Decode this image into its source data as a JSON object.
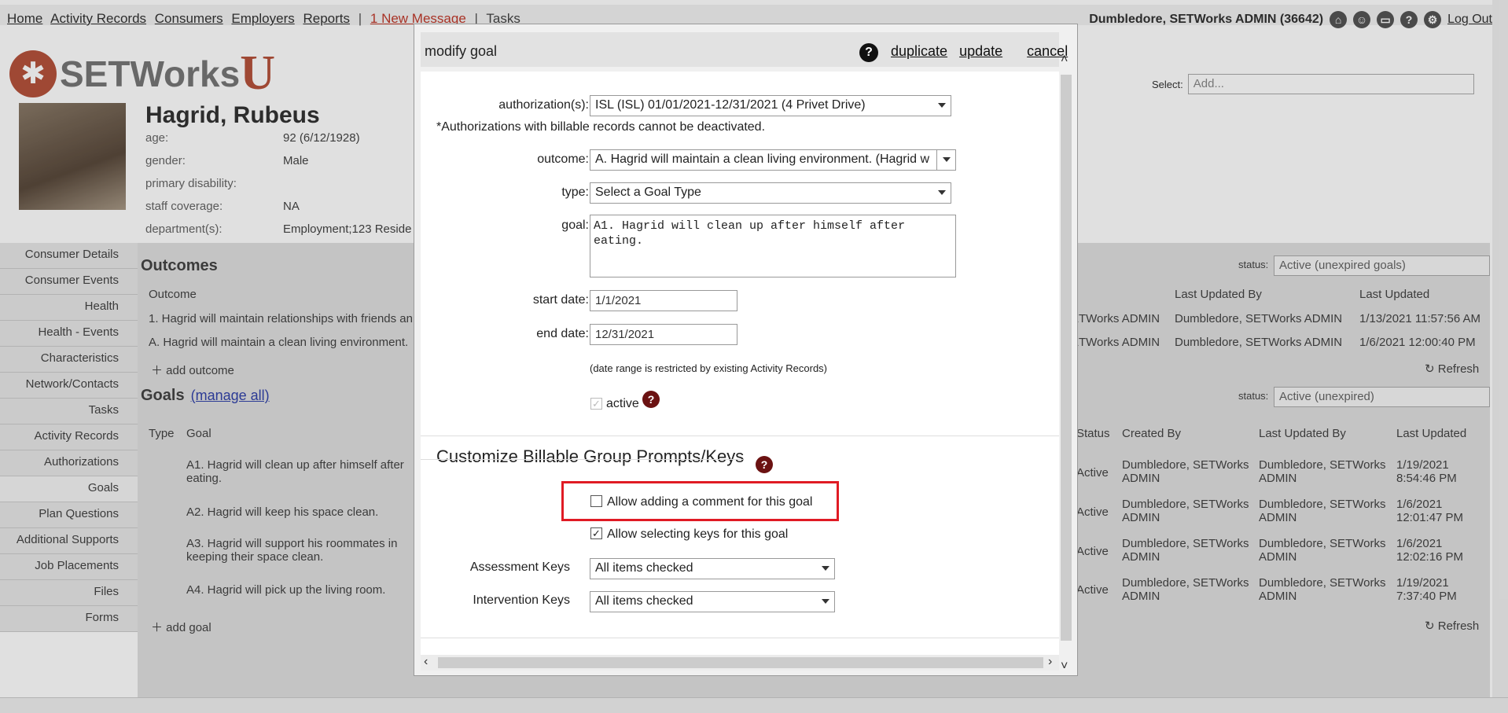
{
  "topnav": {
    "links": [
      "Home",
      "Activity Records",
      "Consumers",
      "Employers",
      "Reports"
    ],
    "message": "1 New Message",
    "tasks": "Tasks"
  },
  "user": {
    "name": "Dumbledore, SETWorks ADMIN  (36642)",
    "logout": "Log Out"
  },
  "logo": {
    "text": "SETWorks",
    "suffix": "U"
  },
  "select_add": {
    "label": "Select:",
    "value": "Add..."
  },
  "consumer": {
    "name": "Hagrid, Rubeus",
    "fields": [
      {
        "k": "age:",
        "v": "92 (6/12/1928)"
      },
      {
        "k": "gender:",
        "v": "Male"
      },
      {
        "k": "primary disability:",
        "v": ""
      },
      {
        "k": "staff coverage:",
        "v": "NA"
      },
      {
        "k": "department(s):",
        "v": "Employment;123 Reside"
      }
    ]
  },
  "leftnav": [
    "Consumer Details",
    "Consumer Events",
    "Health",
    "Health - Events",
    "Characteristics",
    "Network/Contacts",
    "Tasks",
    "Activity Records",
    "Authorizations",
    "Goals",
    "Plan Questions",
    "Additional Supports",
    "Job Placements",
    "Files",
    "Forms"
  ],
  "outcomes": {
    "title": "Outcomes",
    "status_label": "status:",
    "status_value": "Active (unexpired goals)",
    "col_outcome": "Outcome",
    "col_updated_by": "Last Updated By",
    "col_updated": "Last Updated",
    "rows": [
      {
        "text": "1. Hagrid will maintain relationships with friends an",
        "created": "ETWorks ADMIN",
        "by": "Dumbledore, SETWorks ADMIN",
        "date": "1/13/2021 11:57:56 AM"
      },
      {
        "text": "A. Hagrid will maintain a clean living environment.",
        "created": "ETWorks ADMIN",
        "by": "Dumbledore, SETWorks ADMIN",
        "date": "1/6/2021 12:00:40 PM"
      }
    ],
    "add": "add outcome",
    "refresh": "Refresh"
  },
  "goals": {
    "title": "Goals",
    "manage": "(manage all)",
    "status_label": "status:",
    "status_value": "Active (unexpired)",
    "cols": [
      "Type",
      "Goal",
      "Status",
      "Created By",
      "Last Updated By",
      "Last Updated"
    ],
    "rows": [
      {
        "goal": "A1. Hagrid will clean up after himself after eating.",
        "status": "Active",
        "created": "Dumbledore, SETWorks ADMIN",
        "by": "Dumbledore, SETWorks ADMIN",
        "date": "1/19/2021 8:54:46 PM"
      },
      {
        "goal": "A2. Hagrid will keep his space clean.",
        "status": "Active",
        "created": "Dumbledore, SETWorks ADMIN",
        "by": "Dumbledore, SETWorks ADMIN",
        "date": "1/6/2021 12:01:47 PM"
      },
      {
        "goal": "A3. Hagrid will support his roommates in keeping their space clean.",
        "status": "Active",
        "created": "Dumbledore, SETWorks ADMIN",
        "by": "Dumbledore, SETWorks ADMIN",
        "date": "1/6/2021 12:02:16 PM"
      },
      {
        "goal": "A4. Hagrid will pick up the living room.",
        "status": "Active",
        "created": "Dumbledore, SETWorks ADMIN",
        "by": "Dumbledore, SETWorks ADMIN",
        "date": "1/19/2021 7:37:40 PM"
      }
    ],
    "add": "add goal",
    "refresh": "Refresh"
  },
  "modal": {
    "title": "modify goal",
    "duplicate": "duplicate",
    "update": "update",
    "cancel": "cancel",
    "authorization_label": "authorization(s):",
    "authorization_value": "ISL (ISL) 01/01/2021-12/31/2021 (4 Privet Drive)",
    "authorization_note": "*Authorizations with billable records cannot be deactivated.",
    "outcome_label": "outcome:",
    "outcome_value": "A. Hagrid will maintain a clean living environment.  (Hagrid w",
    "type_label": "type:",
    "type_value": "Select a Goal Type",
    "goal_label": "goal:",
    "goal_value": "A1. Hagrid will clean up after himself after eating.",
    "start_label": "start date:",
    "start_value": "1/1/2021",
    "end_label": "end date:",
    "end_value": "12/31/2021",
    "date_note": "(date range is restricted by existing Activity Records)",
    "active_label": "active",
    "active_checked": true,
    "section_title": "Customize Billable Group Prompts/Keys",
    "allow_comment_label": "Allow adding a comment for this goal",
    "allow_comment_checked": false,
    "allow_keys_label": "Allow selecting keys for this goal",
    "allow_keys_checked": true,
    "assessment_label": "Assessment Keys",
    "assessment_value": "All items checked",
    "intervention_label": "Intervention Keys",
    "intervention_value": "All items checked"
  },
  "colors": {
    "highlight": "#e01b24",
    "help_red": "#6b1212",
    "brand": "#b5533c"
  }
}
